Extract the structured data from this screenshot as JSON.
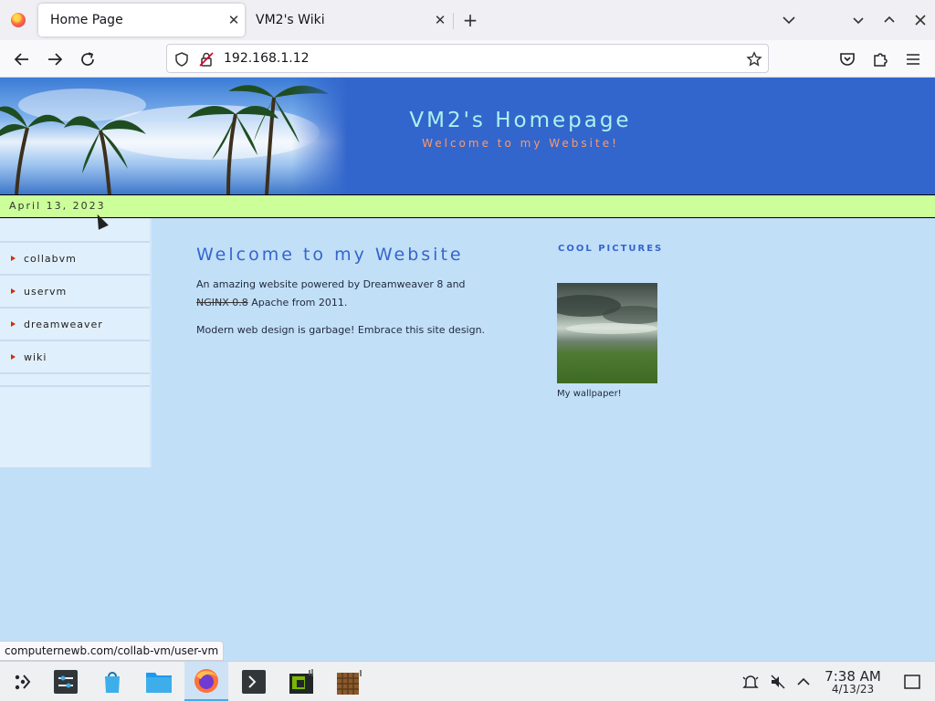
{
  "browser": {
    "tabs": [
      {
        "label": "Home Page",
        "active": true
      },
      {
        "label": "VM2's Wiki",
        "active": false
      }
    ],
    "url": "192.168.1.12",
    "status_link": "computernewb.com/collab-vm/user-vm"
  },
  "site": {
    "title": "VM2's Homepage",
    "tagline": "Welcome to my Website!",
    "date": "April 13, 2023",
    "nav": [
      {
        "label": "collabvm"
      },
      {
        "label": "uservm"
      },
      {
        "label": "dreamweaver"
      },
      {
        "label": "wiki"
      }
    ],
    "welcome_heading": "Welcome to my Website",
    "para1_before": "An amazing website powered by Dreamweaver 8 and ",
    "para1_struck": "NGINX 0.8",
    "para1_after": " Apache from 2011.",
    "para2": "Modern web design is garbage! Embrace this site design.",
    "pictures_heading": "COOL PICTURES",
    "wallpaper_caption": "My wallpaper!",
    "colors": {
      "header_blue": "#3366cc",
      "title_cyan": "#aef0ef",
      "tagline_orange": "#ff9966",
      "date_bar_green": "#ccff99",
      "page_bg": "#c2dff8"
    }
  },
  "taskbar": {
    "apps": [
      {
        "name": "app-launcher-icon"
      },
      {
        "name": "system-settings-icon"
      },
      {
        "name": "discover-store-icon"
      },
      {
        "name": "file-manager-icon"
      },
      {
        "name": "firefox-icon",
        "active": true
      },
      {
        "name": "terminal-icon"
      },
      {
        "name": "nvidia-settings-icon"
      },
      {
        "name": "minecraft-icon"
      }
    ],
    "clock_time": "7:38 AM",
    "clock_date": "4/13/23"
  }
}
